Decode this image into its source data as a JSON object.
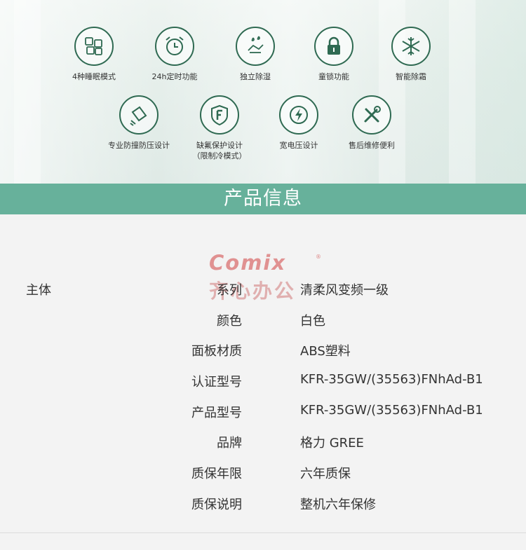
{
  "features": [
    {
      "label": "4种睡眠模式",
      "icon": "sleep-cards-icon"
    },
    {
      "label": "24h定时功能",
      "icon": "alarm-clock-icon"
    },
    {
      "label": "独立除湿",
      "icon": "dehumidify-icon"
    },
    {
      "label": "童锁功能",
      "icon": "padlock-icon"
    },
    {
      "label": "智能除霜",
      "icon": "snowflake-icon"
    },
    {
      "label": "专业防撞防压设计",
      "icon": "anti-collision-icon"
    },
    {
      "label": "缺氟保护设计\n（限制冷模式）",
      "icon": "fluorine-shield-icon"
    },
    {
      "label": "宽电压设计",
      "icon": "voltage-bolt-icon"
    },
    {
      "label": "售后维修便利",
      "icon": "repair-tools-icon"
    }
  ],
  "banner": {
    "title": "产品信息"
  },
  "watermark": {
    "brand": "Comix",
    "registered": "®",
    "sub": "齐心办公"
  },
  "spec": {
    "group": "主体",
    "rows": [
      {
        "key": "系列",
        "value": "清柔风变频一级"
      },
      {
        "key": "颜色",
        "value": "白色"
      },
      {
        "key": "面板材质",
        "value": "ABS塑料"
      },
      {
        "key": "认证型号",
        "value": "KFR-35GW/(35563)FNhAd-B1"
      },
      {
        "key": "产品型号",
        "value": "KFR-35GW/(35563)FNhAd-B1"
      },
      {
        "key": "品牌",
        "value": "格力 GREE"
      },
      {
        "key": "质保年限",
        "value": "六年质保"
      },
      {
        "key": "质保说明",
        "value": "整机六年保修"
      }
    ]
  },
  "colors": {
    "accent": "#67b19b",
    "icon_stroke": "#2f6a52",
    "watermark": "#cf3f3f"
  }
}
